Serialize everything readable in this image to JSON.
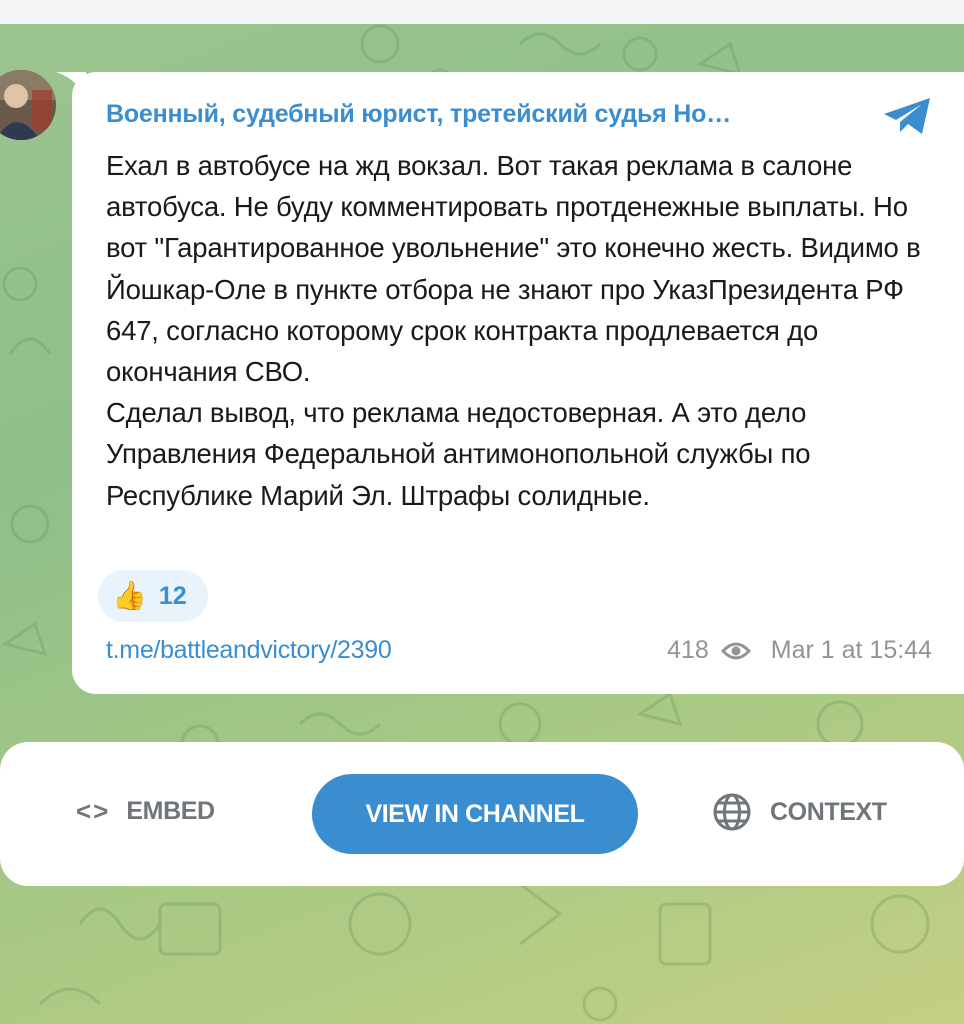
{
  "post": {
    "channel_title": "Военный, судебный юрист, третейский судья Но…",
    "paragraphs": [
      "Ехал в автобусе на жд вокзал. Вот такая реклама в салоне автобуса. Не буду комментировать протденежные выплаты. Но вот \"Гарантированное увольнение\" это конечно жесть. Видимо в Йошкар-Оле в пункте отбора не знают про УказПрезидента РФ 647, согласно которому срок контракта продлевается до окончания СВО.",
      "Сделал вывод, что реклама недостоверная. А это дело Управления Федеральной антимонопольной службы по Республике Марий Эл. Штрафы солидные."
    ],
    "reaction": {
      "emoji": "👍",
      "count": "12"
    },
    "link": "t.me/battleandvictory/2390",
    "views": "418",
    "date": "Mar 1 at 15:44"
  },
  "actions": {
    "embed_label": "EMBED",
    "embed_icon": "<>",
    "view_label": "VIEW IN CHANNEL",
    "context_label": "CONTEXT"
  },
  "colors": {
    "accent": "#3a8ed0",
    "muted": "#909498",
    "text": "#1a1a1a"
  },
  "icons": [
    "telegram-icon",
    "eye-icon",
    "code-icon",
    "globe-icon"
  ]
}
